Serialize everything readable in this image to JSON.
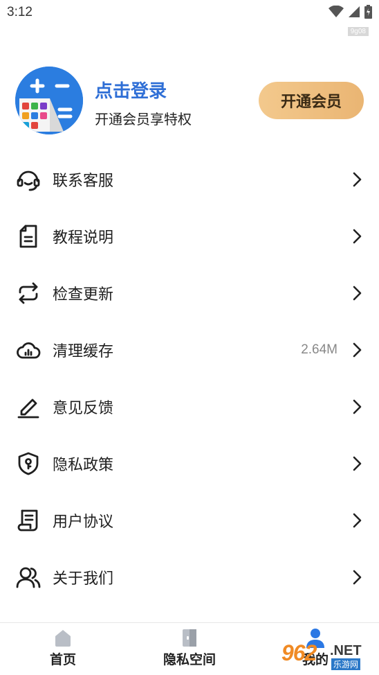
{
  "status_bar": {
    "time": "3:12",
    "tag": "9g08"
  },
  "profile": {
    "login_title": "点击登录",
    "login_subtitle": "开通会员享特权",
    "vip_button": "开通会员"
  },
  "menu": [
    {
      "label": "联系客服",
      "icon": "headset-icon",
      "value": ""
    },
    {
      "label": "教程说明",
      "icon": "document-icon",
      "value": ""
    },
    {
      "label": "检查更新",
      "icon": "refresh-icon",
      "value": ""
    },
    {
      "label": "清理缓存",
      "icon": "cloud-chart-icon",
      "value": "2.64M"
    },
    {
      "label": "意见反馈",
      "icon": "pen-icon",
      "value": ""
    },
    {
      "label": "隐私政策",
      "icon": "shield-key-icon",
      "value": ""
    },
    {
      "label": "用户协议",
      "icon": "scroll-icon",
      "value": ""
    },
    {
      "label": "关于我们",
      "icon": "users-icon",
      "value": ""
    }
  ],
  "tabbar": {
    "tabs": [
      {
        "label": "首页",
        "icon": "home-icon"
      },
      {
        "label": "隐私空间",
        "icon": "door-icon"
      },
      {
        "label": "我的",
        "icon": "person-icon",
        "active": true
      }
    ]
  },
  "watermark": {
    "number": "962",
    "net": ".NET",
    "sub": "乐游网"
  },
  "colors": {
    "accent": "#2f6fd6",
    "vip_gradient_start": "#f3c98d",
    "vip_gradient_end": "#eab573",
    "active_tab": "#2b78e4"
  }
}
